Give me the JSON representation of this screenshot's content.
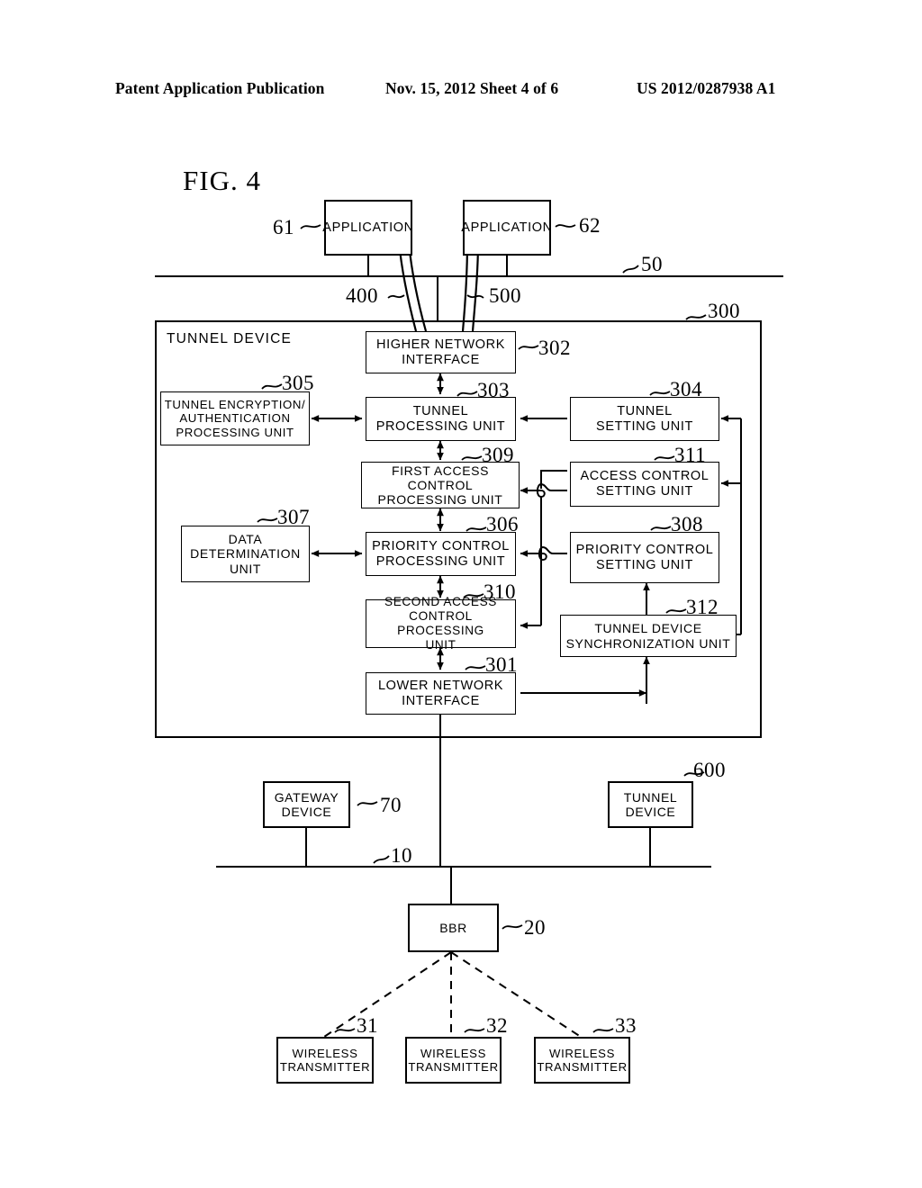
{
  "header": {
    "left": "Patent Application Publication",
    "middle": "Nov. 15, 2012  Sheet 4 of 6",
    "right": "US 2012/0287938 A1"
  },
  "figure": {
    "title": "FIG. 4"
  },
  "diagram": {
    "type": "block-diagram",
    "container": {
      "label": "TUNNEL DEVICE",
      "ref": "300"
    },
    "boxes": [
      {
        "id": "app61",
        "label": "APPLICATION",
        "ref": "61"
      },
      {
        "id": "app62",
        "label": "APPLICATION",
        "ref": "62"
      },
      {
        "id": "hni",
        "label": "HIGHER NETWORK\nINTERFACE",
        "ref": "302"
      },
      {
        "id": "tenc",
        "label": "TUNNEL ENCRYPTION/\nAUTHENTICATION\nPROCESSING UNIT",
        "ref": "305"
      },
      {
        "id": "tpu",
        "label": "TUNNEL\nPROCESSING UNIT",
        "ref": "303"
      },
      {
        "id": "tsu",
        "label": "TUNNEL\nSETTING UNIT",
        "ref": "304"
      },
      {
        "id": "facpu",
        "label": "FIRST ACCESS CONTROL\nPROCESSING UNIT",
        "ref": "309"
      },
      {
        "id": "acsu",
        "label": "ACCESS CONTROL\nSETTING UNIT",
        "ref": "311"
      },
      {
        "id": "ddu",
        "label": "DATA\nDETERMINATION\nUNIT",
        "ref": "307"
      },
      {
        "id": "pcpu",
        "label": "PRIORITY CONTROL\nPROCESSING UNIT",
        "ref": "306"
      },
      {
        "id": "pcsu",
        "label": "PRIORITY CONTROL\nSETTING UNIT",
        "ref": "308"
      },
      {
        "id": "sacpu",
        "label": "SECOND ACCESS\nCONTROL PROCESSING\nUNIT",
        "ref": "310"
      },
      {
        "id": "tdsu",
        "label": "TUNNEL DEVICE\nSYNCHRONIZATION UNIT",
        "ref": "312"
      },
      {
        "id": "lni",
        "label": "LOWER NETWORK\nINTERFACE",
        "ref": "301"
      },
      {
        "id": "gw",
        "label": "GATEWAY\nDEVICE",
        "ref": "70"
      },
      {
        "id": "td600",
        "label": "TUNNEL\nDEVICE",
        "ref": "600"
      },
      {
        "id": "bbr",
        "label": "BBR",
        "ref": "20"
      },
      {
        "id": "wt31",
        "label": "WIRELESS\nTRANSMITTER",
        "ref": "31"
      },
      {
        "id": "wt32",
        "label": "WIRELESS\nTRANSMITTER",
        "ref": "32"
      },
      {
        "id": "wt33",
        "label": "WIRELESS\nTRANSMITTER",
        "ref": "33"
      }
    ],
    "bus_refs": [
      {
        "id": "bus50",
        "ref": "50"
      },
      {
        "id": "bus10",
        "ref": "10"
      }
    ],
    "tunnel_refs": [
      {
        "id": "tunnel400",
        "ref": "400"
      },
      {
        "id": "tunnel500",
        "ref": "500"
      }
    ]
  }
}
